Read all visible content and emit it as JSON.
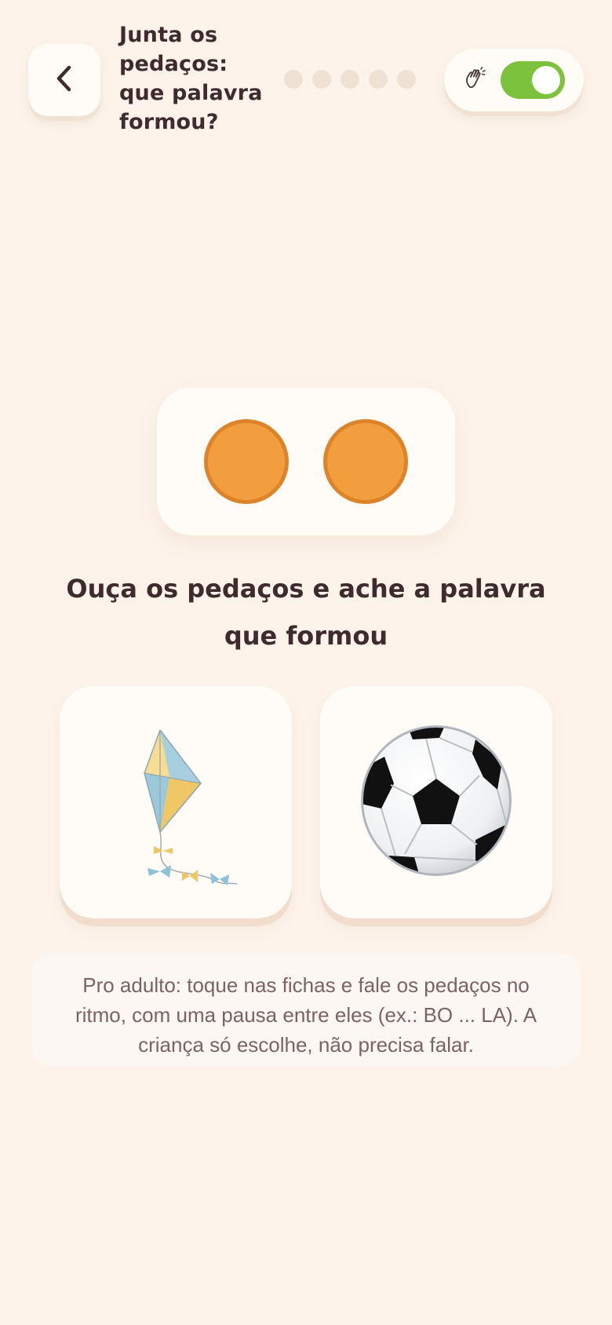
{
  "header": {
    "title": "Junta os pedaços: que palavra formou?",
    "back_icon": "chevron-left-icon",
    "progress_total": 5,
    "progress_done": 0,
    "progress_dot_color": "#f0e2d2",
    "toggle": {
      "icon": "waving-hand-icon",
      "on": true,
      "color": "#7cc23d"
    }
  },
  "chips": {
    "count": 2,
    "color": "#f39e3e",
    "border_color": "#dd832a"
  },
  "prompt": "Ouça os pedaços e ache a palavra que formou",
  "options": [
    {
      "icon": "kite-icon"
    },
    {
      "icon": "soccer-ball-icon"
    }
  ],
  "note": "Pro adulto: toque nas fichas e fale os pedaços no ritmo, com uma pausa entre eles (ex.: BO ... LA). A criança só escolhe, não precisa falar.",
  "colors": {
    "background": "#fdf3ea",
    "text": "#3f2a2e",
    "card": "#fffcf8"
  }
}
